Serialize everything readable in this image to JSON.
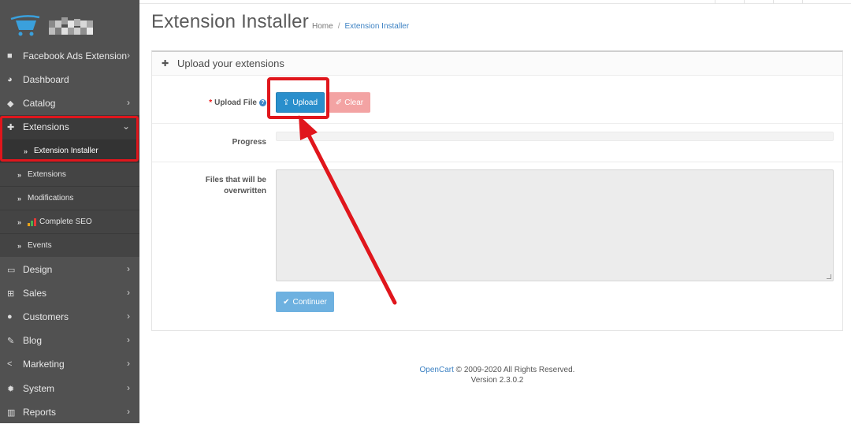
{
  "sidebar": {
    "menu": [
      {
        "label": "Facebook Ads Extension",
        "icon": "facebook-icon",
        "chevron": true
      },
      {
        "label": "Dashboard",
        "icon": "dashboard-icon",
        "chevron": false
      },
      {
        "label": "Catalog",
        "icon": "tag-icon",
        "chevron": true
      },
      {
        "label": "Extensions",
        "icon": "puzzle-icon",
        "chevron": true
      },
      {
        "label": "Design",
        "icon": "monitor-icon",
        "chevron": true
      },
      {
        "label": "Sales",
        "icon": "cart-icon",
        "chevron": true
      },
      {
        "label": "Customers",
        "icon": "user-icon",
        "chevron": true
      },
      {
        "label": "Blog",
        "icon": "edit-icon",
        "chevron": true
      },
      {
        "label": "Marketing",
        "icon": "share-icon",
        "chevron": true
      },
      {
        "label": "System",
        "icon": "cog-icon",
        "chevron": true
      },
      {
        "label": "Reports",
        "icon": "bar-chart-icon",
        "chevron": true
      }
    ],
    "submenu": [
      {
        "label": "Extension Installer",
        "current": true
      },
      {
        "label": "Extensions"
      },
      {
        "label": "Modifications"
      },
      {
        "label": "Complete SEO"
      },
      {
        "label": "Events"
      }
    ]
  },
  "page": {
    "title": "Extension Installer",
    "breadcrumb": [
      "Home",
      "Extension Installer"
    ]
  },
  "panel": {
    "heading": "Upload your extensions",
    "upload_label": "Upload File",
    "upload_button": "Upload",
    "clear_button": "Clear",
    "progress_label": "Progress",
    "progress_value": 0,
    "overwrite_label_line1": "Files that will be",
    "overwrite_label_line2": "overwritten",
    "continue_button": "Continuer"
  },
  "footer": {
    "brand": "OpenCart",
    "copyright": " © 2009-2020 All Rights Reserved.",
    "version": "Version 2.3.0.2"
  },
  "colors": {
    "sidebar_bg": "#515151",
    "primary": "#2a8fcc",
    "danger_light": "#f3a3a3",
    "annotation_red": "#e0161c",
    "link": "#3d82c3"
  }
}
